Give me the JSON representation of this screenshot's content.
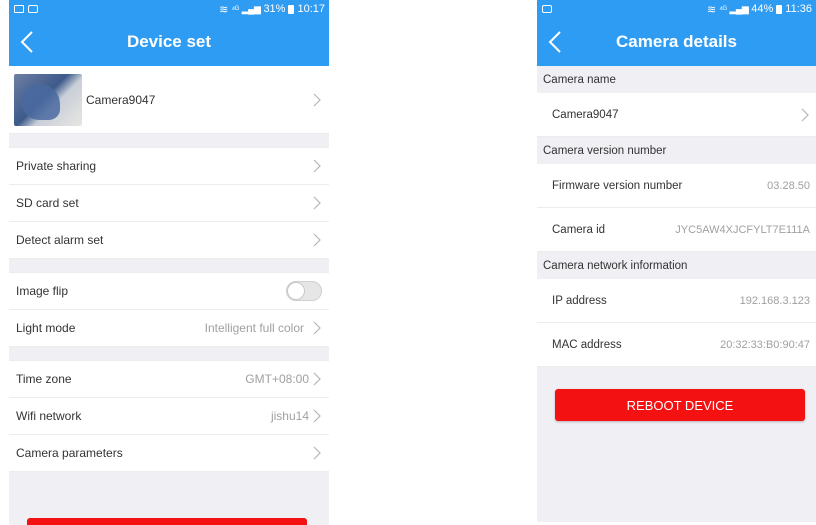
{
  "left": {
    "status": {
      "signal": "⁴ᴳ",
      "battery": "31%",
      "time": "10:17"
    },
    "title": "Device set",
    "camera": {
      "name": "Camera9047"
    },
    "rows": {
      "private_sharing": "Private sharing",
      "sd_card_set": "SD card set",
      "detect_alarm_set": "Detect alarm set",
      "image_flip": "Image flip",
      "light_mode": "Light mode",
      "light_mode_value": "Intelligent full color",
      "time_zone": "Time zone",
      "time_zone_value": "GMT+08:00",
      "wifi_network": "Wifi network",
      "wifi_network_value": "jishu14",
      "camera_parameters": "Camera parameters"
    },
    "image_flip_on": false
  },
  "right": {
    "status": {
      "signal": "⁴ᴳ",
      "battery": "44%",
      "time": "11:36"
    },
    "title": "Camera details",
    "sections": {
      "camera_name": "Camera name",
      "camera_version": "Camera version number",
      "network_info": "Camera network information"
    },
    "rows": {
      "camera_name_value": "Camera9047",
      "firmware_label": "Firmware version number",
      "firmware_value": "03.28.50",
      "camera_id_label": "Camera id",
      "camera_id_value": "JYC5AW4XJCFYLT7E111A",
      "ip_label": "IP address",
      "ip_value": "192.168.3.123",
      "mac_label": "MAC address",
      "mac_value": "20:32:33:B0:90:47"
    },
    "reboot_label": "REBOOT DEVICE"
  },
  "colors": {
    "accent": "#2f9cf3",
    "danger": "#f41111",
    "background": "#efeff4"
  }
}
